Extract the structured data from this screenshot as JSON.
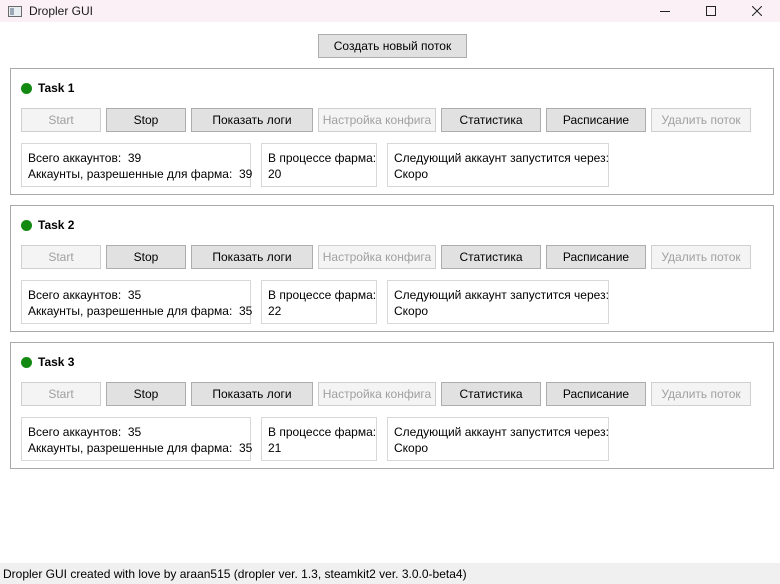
{
  "window": {
    "title": "Dropler GUI",
    "minimize_glyph": "—",
    "close_glyph": "✕"
  },
  "toolbar": {
    "new_thread_label": "Создать новый поток"
  },
  "labels": {
    "start": "Start",
    "stop": "Stop",
    "show_logs": "Показать логи",
    "config": "Настройка конфига",
    "stats": "Статистика",
    "schedule": "Расписание",
    "delete": "Удалить поток",
    "total_accounts": "Всего аккаунтов:",
    "allowed_accounts": "Аккаунты, разрешенные для фарма:",
    "in_progress": "В процессе фарма:",
    "next_account": "Следующий аккаунт запустится через:"
  },
  "colors": {
    "status_running": "#128a12"
  },
  "tasks": [
    {
      "name": "Task 1",
      "total": "39",
      "allowed": "39",
      "in_progress": "20",
      "next": "Скоро"
    },
    {
      "name": "Task 2",
      "total": "35",
      "allowed": "35",
      "in_progress": "22",
      "next": "Скоро"
    },
    {
      "name": "Task 3",
      "total": "35",
      "allowed": "35",
      "in_progress": "21",
      "next": "Скоро"
    }
  ],
  "statusbar": {
    "text": "Dropler GUI created with love by araan515 (dropler ver. 1.3, steamkit2 ver. 3.0.0-beta4)"
  }
}
